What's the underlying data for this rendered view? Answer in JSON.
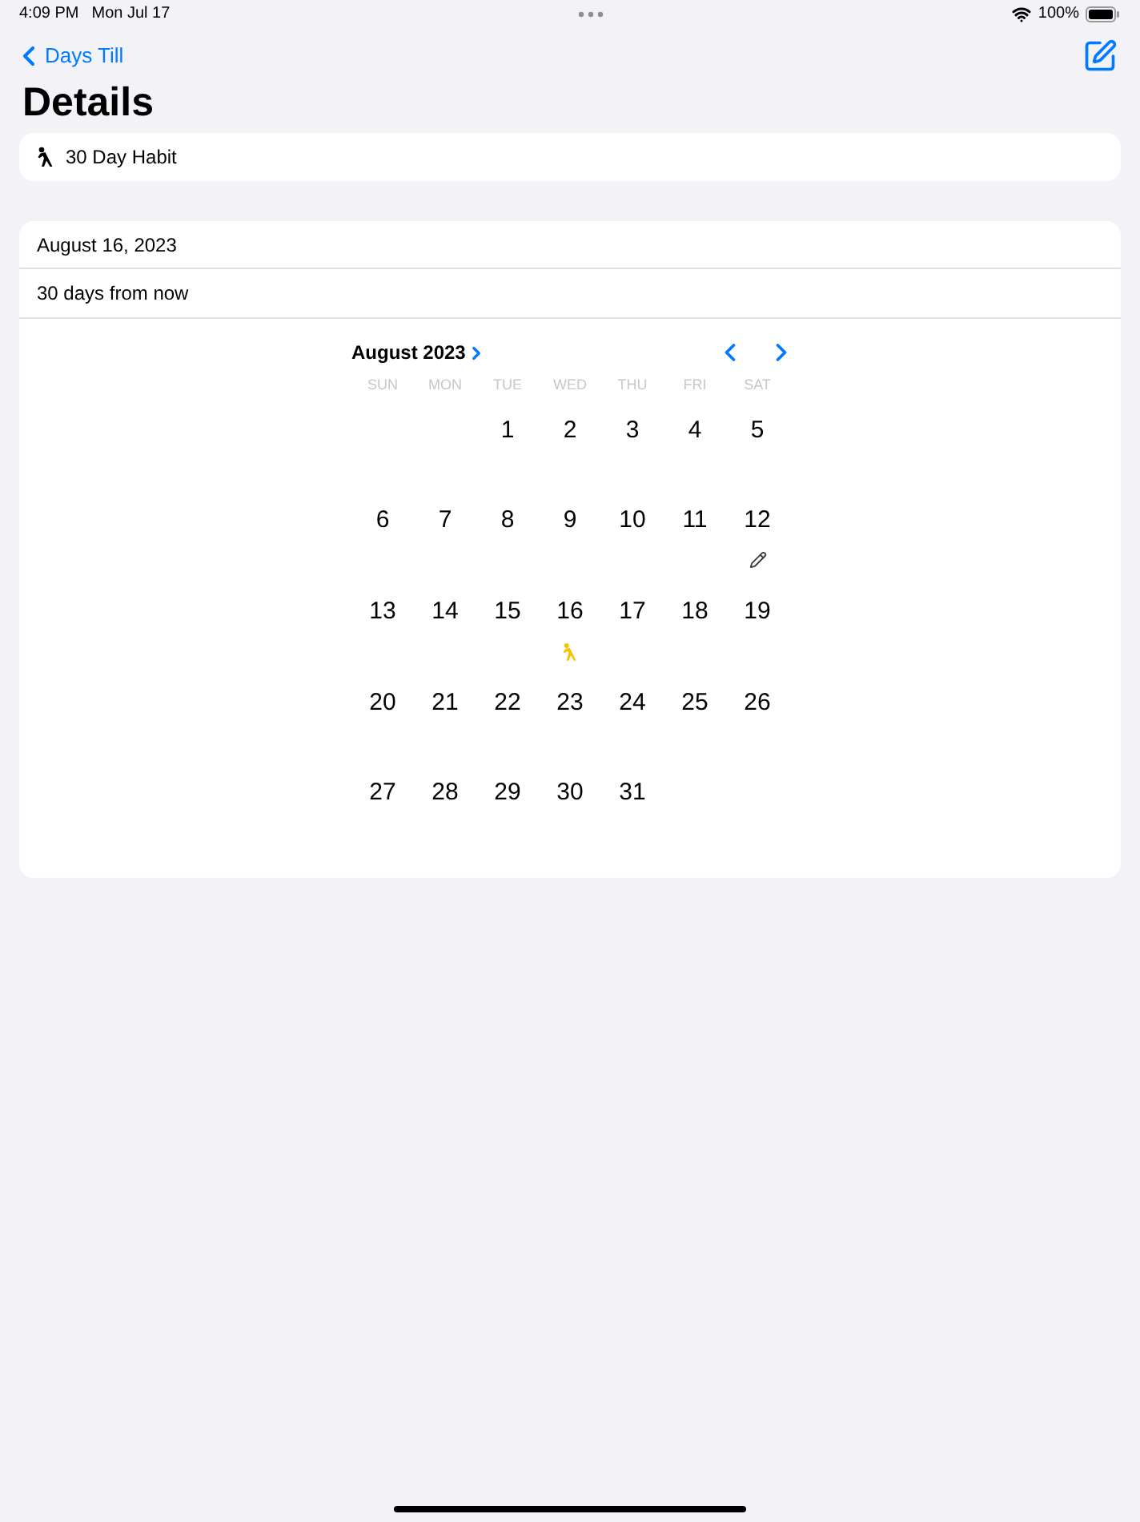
{
  "status_bar": {
    "time": "4:09 PM",
    "date": "Mon Jul 17",
    "battery": "100%"
  },
  "nav": {
    "back": "Days Till",
    "title": "Details"
  },
  "habit": {
    "name": "30 Day Habit"
  },
  "details": {
    "date": "August 16, 2023",
    "relative": "30 days from now"
  },
  "calendar": {
    "month": "August 2023",
    "weekdays": [
      "SUN",
      "MON",
      "TUE",
      "WED",
      "THU",
      "FRI",
      "SAT"
    ],
    "weeks": [
      {
        "days": [
          {
            "day": "1"
          },
          {
            "day": "2"
          },
          {
            "day": "3"
          },
          {
            "day": "4"
          },
          {
            "day": "5"
          }
        ]
      },
      {
        "days": [
          {
            "day": "6"
          },
          {
            "day": "7"
          },
          {
            "day": "8"
          },
          {
            "day": "9"
          },
          {
            "day": "10"
          },
          {
            "day": "11"
          },
          {
            "day": "12",
            "marker": {
              "kind": "pencil",
              "color": "#3a3a3c"
            }
          }
        ]
      },
      {
        "days": [
          {
            "day": "13"
          },
          {
            "day": "14"
          },
          {
            "day": "15"
          },
          {
            "day": "16",
            "marker": {
              "kind": "figure",
              "color": "#f5c400"
            }
          },
          {
            "day": "17"
          },
          {
            "day": "18"
          },
          {
            "day": "19"
          }
        ]
      },
      {
        "days": [
          {
            "day": "20"
          },
          {
            "day": "21"
          },
          {
            "day": "22"
          },
          {
            "day": "23"
          },
          {
            "day": "24"
          },
          {
            "day": "25"
          },
          {
            "day": "26"
          }
        ]
      },
      {
        "days": [
          {
            "day": "27"
          },
          {
            "day": "28"
          },
          {
            "day": "29"
          },
          {
            "day": "30"
          },
          {
            "day": "31"
          }
        ]
      }
    ]
  }
}
